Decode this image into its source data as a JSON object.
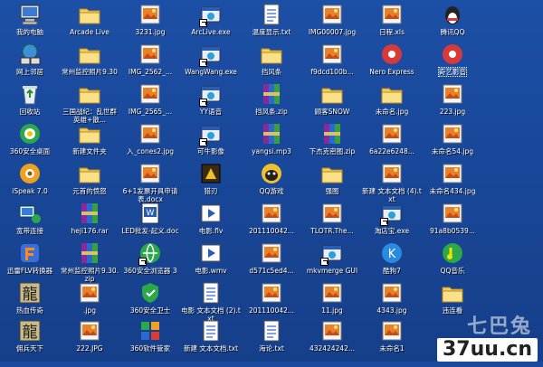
{
  "desktop": {
    "icons": [
      {
        "label": "我的电脑",
        "type": "computer"
      },
      {
        "label": "网上邻居",
        "type": "network"
      },
      {
        "label": "回收站",
        "type": "recycle"
      },
      {
        "label": "360安全桌面",
        "type": "app360"
      },
      {
        "label": "iSpeak 7.0",
        "type": "speak"
      },
      {
        "label": "宽带连接",
        "type": "broadband"
      },
      {
        "label": "迅雷FLV转换器",
        "type": "flv"
      },
      {
        "label": "热血传奇",
        "type": "dragon"
      },
      {
        "label": "佣兵天下",
        "type": "dragon"
      },
      {
        "label": "Arcade Live",
        "type": "folder"
      },
      {
        "label": "常州监控照片9.30",
        "type": "folder"
      },
      {
        "label": "三国战纪：乱世群英雄+散...",
        "type": "folder"
      },
      {
        "label": "新建文件夹",
        "type": "folder"
      },
      {
        "label": "元首的愤怒",
        "type": "folder"
      },
      {
        "label": "heji176.rar",
        "type": "rar"
      },
      {
        "label": "常州监控照片9.30.zip",
        "type": "rar"
      },
      {
        "label": ".jpg",
        "type": "image"
      },
      {
        "label": "222.JPG",
        "type": "image"
      },
      {
        "label": "3231.jpg",
        "type": "image"
      },
      {
        "label": "IMG_2562_...",
        "type": "image"
      },
      {
        "label": "IMG_2565_...",
        "type": "image"
      },
      {
        "label": "入_cones2.jpg",
        "type": "image"
      },
      {
        "label": "6+1发票开具申请表.docx",
        "type": "image"
      },
      {
        "label": "LED批发-起义.doc",
        "type": "word"
      },
      {
        "label": "360安全浏览器 3",
        "type": "browser"
      },
      {
        "label": "360安全卫士",
        "type": "shield"
      },
      {
        "label": "360软件管家",
        "type": "softmgr"
      },
      {
        "label": "ArcLive.exe",
        "type": "exe"
      },
      {
        "label": "WangWang.exe",
        "type": "exe"
      },
      {
        "label": "YY语音",
        "type": "exe"
      },
      {
        "label": "可牛影像",
        "type": "exe"
      },
      {
        "label": "猎刃",
        "type": "gamebox"
      },
      {
        "label": "电影.flv",
        "type": "video"
      },
      {
        "label": "电影.wmv",
        "type": "video"
      },
      {
        "label": "电影 文本文档 (2).txt",
        "type": "txt"
      },
      {
        "label": "新建 文本文档.txt",
        "type": "txt"
      },
      {
        "label": "温度显示.txt",
        "type": "txt"
      },
      {
        "label": "挡风条",
        "type": "folder"
      },
      {
        "label": "挡风条.zip",
        "type": "rar"
      },
      {
        "label": "yangsi.mp3",
        "type": "rar"
      },
      {
        "label": "QQ游戏",
        "type": "qqgame"
      },
      {
        "label": "201110042...",
        "type": "image"
      },
      {
        "label": "d571c5ed4...",
        "type": "image"
      },
      {
        "label": "201110042...",
        "type": "image"
      },
      {
        "label": "海论.txt",
        "type": "txt"
      },
      {
        "label": "IMG00007.jpg",
        "type": "image"
      },
      {
        "label": "f9dcd100b...",
        "type": "image"
      },
      {
        "label": "顾客SNOW",
        "type": "folder"
      },
      {
        "label": "下杰克密图.zip",
        "type": "rar"
      },
      {
        "label": "强图",
        "type": "folder"
      },
      {
        "label": "TLOTR.The...",
        "type": "image"
      },
      {
        "label": "mkvmerge GUI",
        "type": "exe"
      },
      {
        "label": "11.jpg",
        "type": "image"
      },
      {
        "label": "432424242...",
        "type": "image"
      },
      {
        "label": "日程.xls",
        "type": "image"
      },
      {
        "label": "Nero Express",
        "type": "nero"
      },
      {
        "label": "未命名.jpg",
        "type": "folder"
      },
      {
        "label": "6a22e6248...",
        "type": "image"
      },
      {
        "label": "新建 文本文档 (4).txt",
        "type": "image"
      },
      {
        "label": "淘店宝.exe",
        "type": "exe"
      },
      {
        "label": "酷狗7",
        "type": "kugou"
      },
      {
        "label": "4343.jpg",
        "type": "image"
      },
      {
        "label": "未命名1",
        "type": "image"
      },
      {
        "label": "腾讯QQ",
        "type": "qq"
      },
      {
        "label": "奇艺影音",
        "type": "nero"
      },
      {
        "label": "223.jpg",
        "type": "image"
      },
      {
        "label": "未命名54.jpg",
        "type": "image"
      },
      {
        "label": "未命名434.jpg",
        "type": "image"
      },
      {
        "label": "91a8b0539...",
        "type": "image"
      },
      {
        "label": "QQ音乐",
        "type": "qqmusic"
      },
      {
        "label": "违连看",
        "type": "folder"
      }
    ],
    "selected_label_index": 64
  },
  "watermark": {
    "brand_cn": "七巴兔",
    "url": "37uu.cn"
  },
  "colors": {
    "background": "#1c4fa6",
    "folder": "#f4cf5c",
    "label_text": "#ffffff",
    "selection": "#316ac5"
  }
}
